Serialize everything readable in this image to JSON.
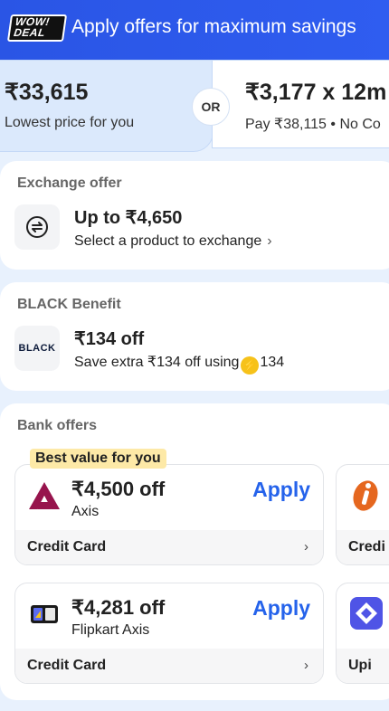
{
  "header": {
    "badge_line1": "WOW!",
    "badge_line2": "DEAL",
    "title": "Apply offers for maximum savings"
  },
  "price_options": {
    "left": {
      "amount": "₹33,615",
      "caption": "Lowest price for you"
    },
    "separator": "OR",
    "right": {
      "amount": "₹3,177 x 12m",
      "caption": "Pay ₹38,115 • No Co"
    }
  },
  "exchange": {
    "title": "Exchange offer",
    "headline": "Up to ₹4,650",
    "subtext": "Select a product to exchange",
    "chevron": "›"
  },
  "black": {
    "title": "BLACK Benefit",
    "logo_text": "BLACK",
    "headline": "₹134 off",
    "subtext": "Save extra ₹134 off using",
    "bolt_icon": "⚡",
    "coins": "134"
  },
  "bank_offers": {
    "title": "Bank offers",
    "best_tag": "Best value for you",
    "offers": [
      {
        "amount": "₹4,500 off",
        "bank": "Axis",
        "action": "Apply",
        "type": "Credit Card",
        "chevron": "›"
      },
      {
        "amount": "₹4,281 off",
        "bank": "Flipkart Axis",
        "action": "Apply",
        "type": "Credit Card",
        "chevron": "›"
      }
    ],
    "peeks": [
      {
        "type": "Credi"
      },
      {
        "type": "Upi"
      }
    ]
  },
  "colors": {
    "header_blue": "#2f5df0",
    "apply_blue": "#2563eb",
    "tag_yellow": "#fde9a7",
    "axis_maroon": "#97144d"
  }
}
